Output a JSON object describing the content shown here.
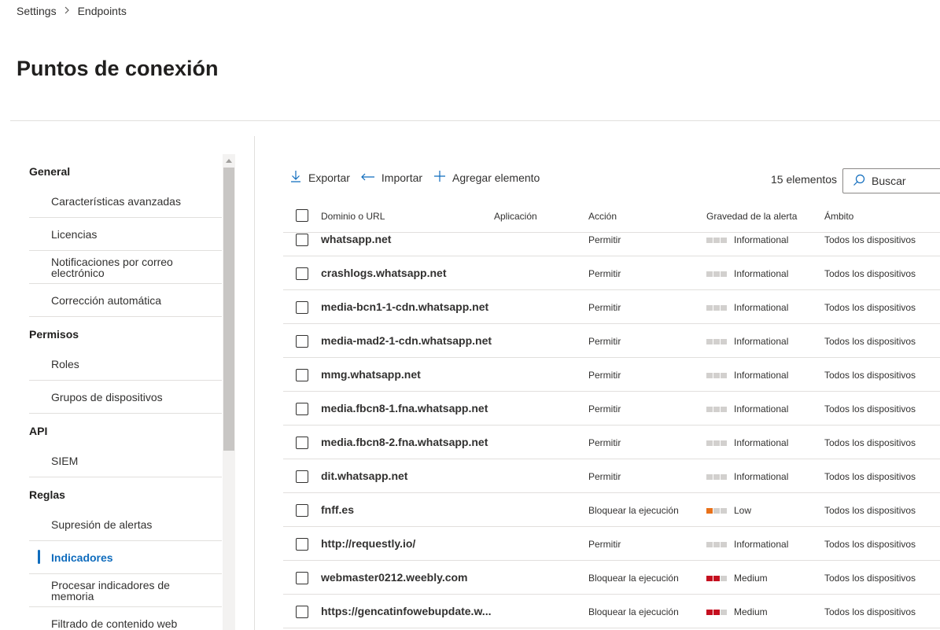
{
  "breadcrumb": {
    "parent": "Settings",
    "current": "Endpoints"
  },
  "page_title": "Puntos de conexión",
  "nav": {
    "groups": {
      "general": "General",
      "permisos": "Permisos",
      "api": "API",
      "reglas": "Reglas"
    },
    "items": [
      "Características avanzadas",
      "Licencias",
      "Notificaciones por correo electrónico",
      "Corrección automática",
      "Roles",
      "Grupos de dispositivos",
      "SIEM",
      "Supresión de alertas",
      "Indicadores",
      "Procesar indicadores de memoria",
      "Filtrado de contenido web"
    ],
    "active": "Indicadores"
  },
  "toolbar": {
    "export_label": "Exportar",
    "import_label": "Importar",
    "add_label": "Agregar elemento",
    "count": "15 elementos",
    "search_placeholder": "Buscar"
  },
  "table": {
    "columns": {
      "domain": "Dominio o URL",
      "app": "Aplicación",
      "action": "Acción",
      "severity": "Gravedad de la alerta",
      "scope": "Ámbito"
    },
    "severity_colors": {
      "low": "#e8711a",
      "medium": "#c50f1f",
      "off": "#d2d0ce"
    },
    "rows": [
      {
        "domain": "whatsapp.net",
        "action": "Permitir",
        "severity": "Informational",
        "level": 0,
        "scope": "Todos los dispositivos"
      },
      {
        "domain": "crashlogs.whatsapp.net",
        "action": "Permitir",
        "severity": "Informational",
        "level": 0,
        "scope": "Todos los dispositivos"
      },
      {
        "domain": "media-bcn1-1-cdn.whatsapp.net",
        "action": "Permitir",
        "severity": "Informational",
        "level": 0,
        "scope": "Todos los dispositivos"
      },
      {
        "domain": "media-mad2-1-cdn.whatsapp.net",
        "action": "Permitir",
        "severity": "Informational",
        "level": 0,
        "scope": "Todos los dispositivos"
      },
      {
        "domain": "mmg.whatsapp.net",
        "action": "Permitir",
        "severity": "Informational",
        "level": 0,
        "scope": "Todos los dispositivos"
      },
      {
        "domain": "media.fbcn8-1.fna.whatsapp.net",
        "action": "Permitir",
        "severity": "Informational",
        "level": 0,
        "scope": "Todos los dispositivos"
      },
      {
        "domain": "media.fbcn8-2.fna.whatsapp.net",
        "action": "Permitir",
        "severity": "Informational",
        "level": 0,
        "scope": "Todos los dispositivos"
      },
      {
        "domain": "dit.whatsapp.net",
        "action": "Permitir",
        "severity": "Informational",
        "level": 0,
        "scope": "Todos los dispositivos"
      },
      {
        "domain": "fnff.es",
        "action": "Bloquear la ejecución",
        "severity": "Low",
        "level": 1,
        "scope": "Todos los dispositivos"
      },
      {
        "domain": "http://requestly.io/",
        "action": "Permitir",
        "severity": "Informational",
        "level": 0,
        "scope": "Todos los dispositivos"
      },
      {
        "domain": "webmaster0212.weebly.com",
        "action": "Bloquear la ejecución",
        "severity": "Medium",
        "level": 2,
        "scope": "Todos los dispositivos"
      },
      {
        "domain": "https://gencatinfowebupdate.w...",
        "action": "Bloquear la ejecución",
        "severity": "Medium",
        "level": 2,
        "scope": "Todos los dispositivos"
      }
    ]
  }
}
